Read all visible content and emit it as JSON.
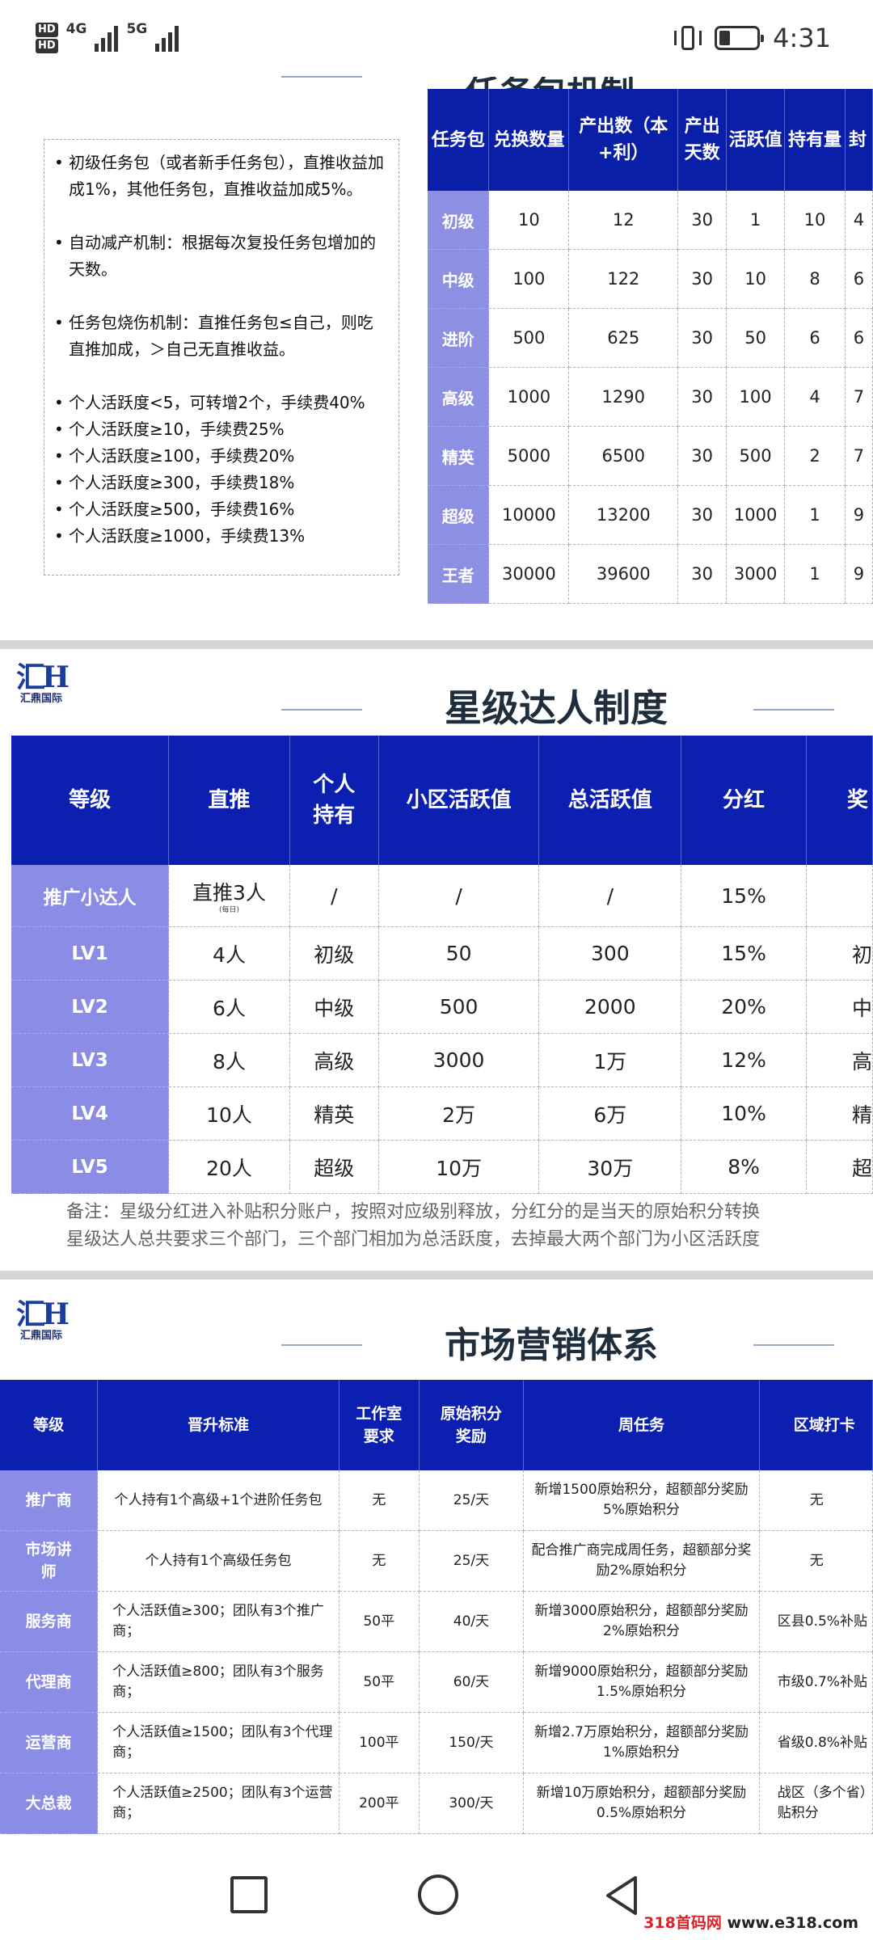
{
  "status_bar": {
    "hd_badges": [
      "HD",
      "HD"
    ],
    "network_1": "4G",
    "network_2": "5G",
    "battery_level_percent": 30,
    "time": "4:31"
  },
  "slide1": {
    "title": "任务包机制",
    "notes": [
      "初级任务包（或者新手任务包），直推收益加成1%，其他任务包，直推收益加成5%。",
      "自动减产机制：根据每次复投任务包增加的天数。",
      "任务包烧伤机制：直推任务包≤自己，则吃直推加成，＞自己无直推收益。",
      "个人活跃度<5，可转增2个，手续费40%",
      "个人活跃度≥10，手续费25%",
      "个人活跃度≥100，手续费20%",
      "个人活跃度≥300，手续费18%",
      "个人活跃度≥500，手续费16%",
      "个人活跃度≥1000，手续费13%"
    ],
    "table": {
      "headers": [
        "任务包",
        "兑换数量",
        "产出数（本+利）",
        "产出天数",
        "活跃值",
        "持有量",
        "封"
      ],
      "rows": [
        [
          "初级",
          "10",
          "12",
          "30",
          "1",
          "10",
          "4"
        ],
        [
          "中级",
          "100",
          "122",
          "30",
          "10",
          "8",
          "6"
        ],
        [
          "进阶",
          "500",
          "625",
          "30",
          "50",
          "6",
          "6"
        ],
        [
          "高级",
          "1000",
          "1290",
          "30",
          "100",
          "4",
          "7"
        ],
        [
          "精英",
          "5000",
          "6500",
          "30",
          "500",
          "2",
          "7"
        ],
        [
          "超级",
          "10000",
          "13200",
          "30",
          "1000",
          "1",
          "9"
        ],
        [
          "王者",
          "30000",
          "39600",
          "30",
          "3000",
          "1",
          "9"
        ]
      ]
    }
  },
  "logo": {
    "mark": "汇H",
    "text": "汇鼎国际"
  },
  "slide2": {
    "title": "星级达人制度",
    "table": {
      "headers": [
        "等级",
        "直推",
        "个人持有",
        "小区活跃值",
        "总活跃值",
        "分红",
        "奖"
      ],
      "rows": [
        [
          "推广小达人",
          "直推3人",
          "/",
          "/",
          "/",
          "15%",
          ""
        ],
        [
          "LV1",
          "4人",
          "初级",
          "50",
          "300",
          "15%",
          "初"
        ],
        [
          "LV2",
          "6人",
          "中级",
          "500",
          "2000",
          "20%",
          "中"
        ],
        [
          "LV3",
          "8人",
          "高级",
          "3000",
          "1万",
          "12%",
          "高"
        ],
        [
          "LV4",
          "10人",
          "精英",
          "2万",
          "6万",
          "10%",
          "精"
        ],
        [
          "LV5",
          "20人",
          "超级",
          "10万",
          "30万",
          "8%",
          "超"
        ]
      ],
      "first_row_note": "(每日)"
    },
    "remarks": [
      "备注：星级分红进入补贴积分账户，按照对应级别释放，分红分的是当天的原始积分转换",
      "星级达人总共要求三个部门，三个部门相加为总活跃度，去掉最大两个部门为小区活跃度"
    ]
  },
  "slide3": {
    "title": "市场营销体系",
    "table": {
      "headers": [
        "等级",
        "晋升标准",
        "工作室要求",
        "原始积分奖励",
        "周任务",
        "区域打卡"
      ],
      "rows": [
        [
          "推广商",
          "个人持有1个高级+1个进阶任务包",
          "无",
          "25/天",
          "新增1500原始积分，超额部分奖励5%原始积分",
          "无"
        ],
        [
          "市场讲师",
          "个人持有1个高级任务包",
          "无",
          "25/天",
          "配合推广商完成周任务，超额部分奖励2%原始积分",
          "无"
        ],
        [
          "服务商",
          "个人活跃值≥300；团队有3个推广商；",
          "50平",
          "40/天",
          "新增3000原始积分，超额部分奖励2%原始积分",
          "区县0.5%补贴"
        ],
        [
          "代理商",
          "个人活跃值≥800；团队有3个服务商；",
          "50平",
          "60/天",
          "新增9000原始积分，超额部分奖励1.5%原始积分",
          "市级0.7%补贴"
        ],
        [
          "运营商",
          "个人活跃值≥1500；团队有3个代理商；",
          "100平",
          "150/天",
          "新增2.7万原始积分，超额部分奖励1%原始积分",
          "省级0.8%补贴"
        ],
        [
          "大总裁",
          "个人活跃值≥2500；团队有3个运营商；",
          "200平",
          "300/天",
          "新增10万原始积分，超额部分奖励0.5%原始积分",
          "战区（多个省）贴积分"
        ]
      ]
    }
  },
  "navbar": {
    "icons": [
      "square-recents-icon",
      "circle-home-icon",
      "triangle-back-icon"
    ]
  },
  "watermark": {
    "brand": "318首码网",
    "url": "www.e318.com"
  }
}
